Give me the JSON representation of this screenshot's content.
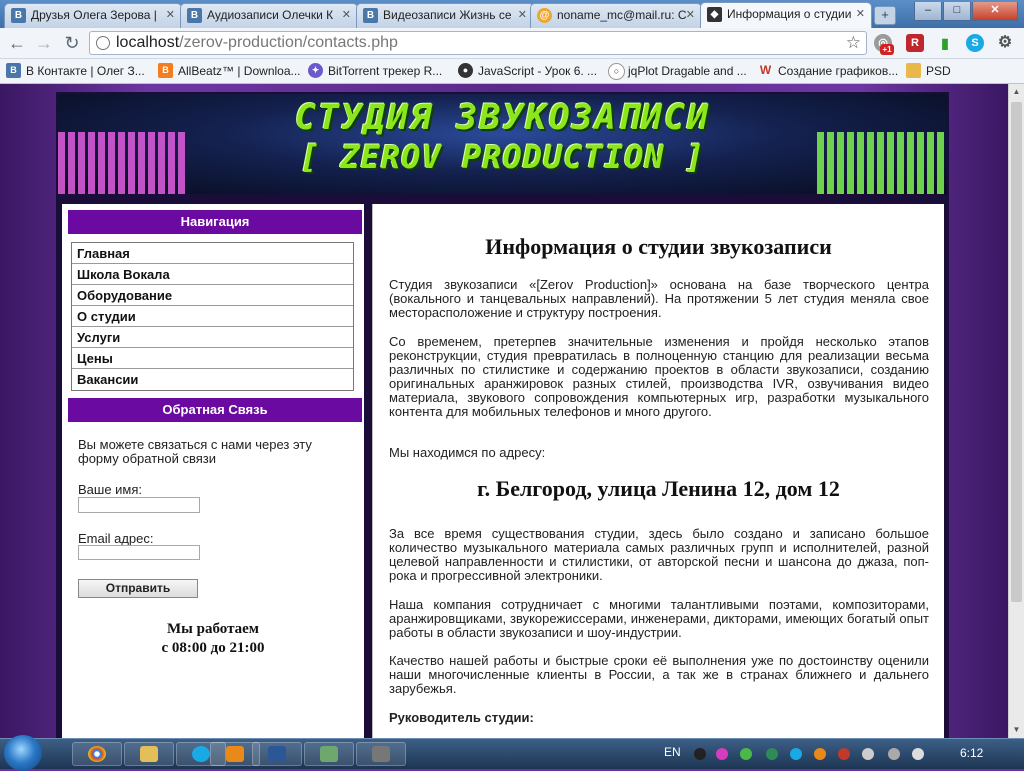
{
  "browser": {
    "tabs": [
      {
        "label": "Друзья Олега Зерова |",
        "favicon": "vk-icon",
        "active": false
      },
      {
        "label": "Аудиозаписи Олечки К",
        "favicon": "vk-icon",
        "active": false
      },
      {
        "label": "Видеозаписи Жизнь се",
        "favicon": "vk-icon",
        "active": false
      },
      {
        "label": "noname_mc@mail.ru: С",
        "favicon": "mail-icon",
        "active": false
      },
      {
        "label": "Информация о студии",
        "favicon": "incognito-icon",
        "active": true
      }
    ],
    "new_tab_label": "+",
    "window_buttons": {
      "minimize": "–",
      "maximize": "□",
      "close": "✕"
    },
    "url_host": "localhost",
    "url_path": "/zerov-production/contacts.php",
    "bookmarks": [
      "В Контакте | Олег З...",
      "AllBeatz™ | Downloa...",
      "BitTorrent трекер R...",
      "JavaScript - Урок 6. ...",
      "jqPlot Dragable and ...",
      "Создание графиков...",
      "PSD"
    ],
    "extension_badge": "+1"
  },
  "site": {
    "banner_line1": "СТУДИЯ ЗВУКОЗАПИСИ",
    "banner_line2": "[ ZEROV PRODUCTION ]",
    "nav_title": "Навигация",
    "nav_items": [
      "Главная",
      "Школа Вокала",
      "Оборудование",
      "О студии",
      "Услуги",
      "Цены",
      "Вакансии"
    ],
    "feedback_title": "Обратная Связь",
    "feedback_intro": "Вы можете связаться с нами через эту форму обратной связи",
    "name_label": "Ваше имя:",
    "email_label": "Email адрес:",
    "send_label": "Отправить",
    "hours_line1": "Мы работаем",
    "hours_line2": "с 08:00 до 21:00",
    "page_title": "Информация о студии звукозаписи",
    "paragraphs": [
      "Студия звукозаписи «[Zerov Production]» основана на базе творческого центра (вокального и танцевальных направлений). На протяжении 5 лет студия меняла свое месторасположение и структуру построения.",
      "Со временем, претерпев значительные изменения и пройдя несколько этапов реконструкции, студия превратилась в полноценную станцию для реализации весьма различных по стилистике и содержанию проектов в области звукозаписи, созданию оригинальных аранжировок разных стилей, производства IVR, озвучивания видео материала, звукового сопровождения компьютерных игр, разработки музыкального контента для мобильных телефонов и много другого.",
      "Мы находимся по адресу:"
    ],
    "address": "г. Белгород, улица Ленина 12, дом 12",
    "paragraphs2": [
      "За все время существования студии, здесь было создано и записано большое количество музыкального материала самых различных групп и исполнителей, разной целевой направленности и стилистики, от авторской песни и шансона до джаза, поп-рока и прогрессивной электроники.",
      "Наша компания сотрудничает с многими талантливыми поэтами, композиторами, аранжировщиками, звукорежиссерами, инженерами, дикторами, имеющих богатый опыт работы в области звукозаписи и шоу-индустрии.",
      "Качество нашей работы и быстрые сроки её выполнения уже по достоинству оценили наши многочисленные клиенты в России, а так же в странах ближнего и дальнего зарубежья."
    ],
    "director_label": "Руководитель студии:"
  },
  "taskbar": {
    "language": "EN",
    "clock": "6:12"
  },
  "colors": {
    "nav_header": "#6a0aa0",
    "banner_text": "#8be61b",
    "page_bg": "#6b2fa0"
  }
}
